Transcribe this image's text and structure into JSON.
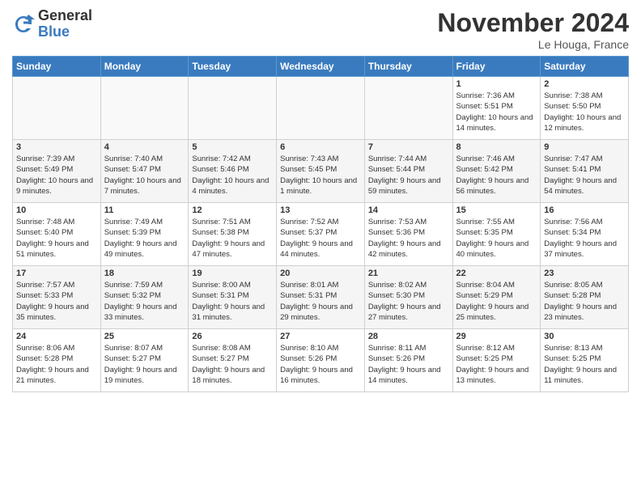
{
  "logo": {
    "general": "General",
    "blue": "Blue"
  },
  "title": "November 2024",
  "location": "Le Houga, France",
  "days_of_week": [
    "Sunday",
    "Monday",
    "Tuesday",
    "Wednesday",
    "Thursday",
    "Friday",
    "Saturday"
  ],
  "weeks": [
    [
      {
        "day": "",
        "info": ""
      },
      {
        "day": "",
        "info": ""
      },
      {
        "day": "",
        "info": ""
      },
      {
        "day": "",
        "info": ""
      },
      {
        "day": "",
        "info": ""
      },
      {
        "day": "1",
        "info": "Sunrise: 7:36 AM\nSunset: 5:51 PM\nDaylight: 10 hours and 14 minutes."
      },
      {
        "day": "2",
        "info": "Sunrise: 7:38 AM\nSunset: 5:50 PM\nDaylight: 10 hours and 12 minutes."
      }
    ],
    [
      {
        "day": "3",
        "info": "Sunrise: 7:39 AM\nSunset: 5:49 PM\nDaylight: 10 hours and 9 minutes."
      },
      {
        "day": "4",
        "info": "Sunrise: 7:40 AM\nSunset: 5:47 PM\nDaylight: 10 hours and 7 minutes."
      },
      {
        "day": "5",
        "info": "Sunrise: 7:42 AM\nSunset: 5:46 PM\nDaylight: 10 hours and 4 minutes."
      },
      {
        "day": "6",
        "info": "Sunrise: 7:43 AM\nSunset: 5:45 PM\nDaylight: 10 hours and 1 minute."
      },
      {
        "day": "7",
        "info": "Sunrise: 7:44 AM\nSunset: 5:44 PM\nDaylight: 9 hours and 59 minutes."
      },
      {
        "day": "8",
        "info": "Sunrise: 7:46 AM\nSunset: 5:42 PM\nDaylight: 9 hours and 56 minutes."
      },
      {
        "day": "9",
        "info": "Sunrise: 7:47 AM\nSunset: 5:41 PM\nDaylight: 9 hours and 54 minutes."
      }
    ],
    [
      {
        "day": "10",
        "info": "Sunrise: 7:48 AM\nSunset: 5:40 PM\nDaylight: 9 hours and 51 minutes."
      },
      {
        "day": "11",
        "info": "Sunrise: 7:49 AM\nSunset: 5:39 PM\nDaylight: 9 hours and 49 minutes."
      },
      {
        "day": "12",
        "info": "Sunrise: 7:51 AM\nSunset: 5:38 PM\nDaylight: 9 hours and 47 minutes."
      },
      {
        "day": "13",
        "info": "Sunrise: 7:52 AM\nSunset: 5:37 PM\nDaylight: 9 hours and 44 minutes."
      },
      {
        "day": "14",
        "info": "Sunrise: 7:53 AM\nSunset: 5:36 PM\nDaylight: 9 hours and 42 minutes."
      },
      {
        "day": "15",
        "info": "Sunrise: 7:55 AM\nSunset: 5:35 PM\nDaylight: 9 hours and 40 minutes."
      },
      {
        "day": "16",
        "info": "Sunrise: 7:56 AM\nSunset: 5:34 PM\nDaylight: 9 hours and 37 minutes."
      }
    ],
    [
      {
        "day": "17",
        "info": "Sunrise: 7:57 AM\nSunset: 5:33 PM\nDaylight: 9 hours and 35 minutes."
      },
      {
        "day": "18",
        "info": "Sunrise: 7:59 AM\nSunset: 5:32 PM\nDaylight: 9 hours and 33 minutes."
      },
      {
        "day": "19",
        "info": "Sunrise: 8:00 AM\nSunset: 5:31 PM\nDaylight: 9 hours and 31 minutes."
      },
      {
        "day": "20",
        "info": "Sunrise: 8:01 AM\nSunset: 5:31 PM\nDaylight: 9 hours and 29 minutes."
      },
      {
        "day": "21",
        "info": "Sunrise: 8:02 AM\nSunset: 5:30 PM\nDaylight: 9 hours and 27 minutes."
      },
      {
        "day": "22",
        "info": "Sunrise: 8:04 AM\nSunset: 5:29 PM\nDaylight: 9 hours and 25 minutes."
      },
      {
        "day": "23",
        "info": "Sunrise: 8:05 AM\nSunset: 5:28 PM\nDaylight: 9 hours and 23 minutes."
      }
    ],
    [
      {
        "day": "24",
        "info": "Sunrise: 8:06 AM\nSunset: 5:28 PM\nDaylight: 9 hours and 21 minutes."
      },
      {
        "day": "25",
        "info": "Sunrise: 8:07 AM\nSunset: 5:27 PM\nDaylight: 9 hours and 19 minutes."
      },
      {
        "day": "26",
        "info": "Sunrise: 8:08 AM\nSunset: 5:27 PM\nDaylight: 9 hours and 18 minutes."
      },
      {
        "day": "27",
        "info": "Sunrise: 8:10 AM\nSunset: 5:26 PM\nDaylight: 9 hours and 16 minutes."
      },
      {
        "day": "28",
        "info": "Sunrise: 8:11 AM\nSunset: 5:26 PM\nDaylight: 9 hours and 14 minutes."
      },
      {
        "day": "29",
        "info": "Sunrise: 8:12 AM\nSunset: 5:25 PM\nDaylight: 9 hours and 13 minutes."
      },
      {
        "day": "30",
        "info": "Sunrise: 8:13 AM\nSunset: 5:25 PM\nDaylight: 9 hours and 11 minutes."
      }
    ]
  ]
}
